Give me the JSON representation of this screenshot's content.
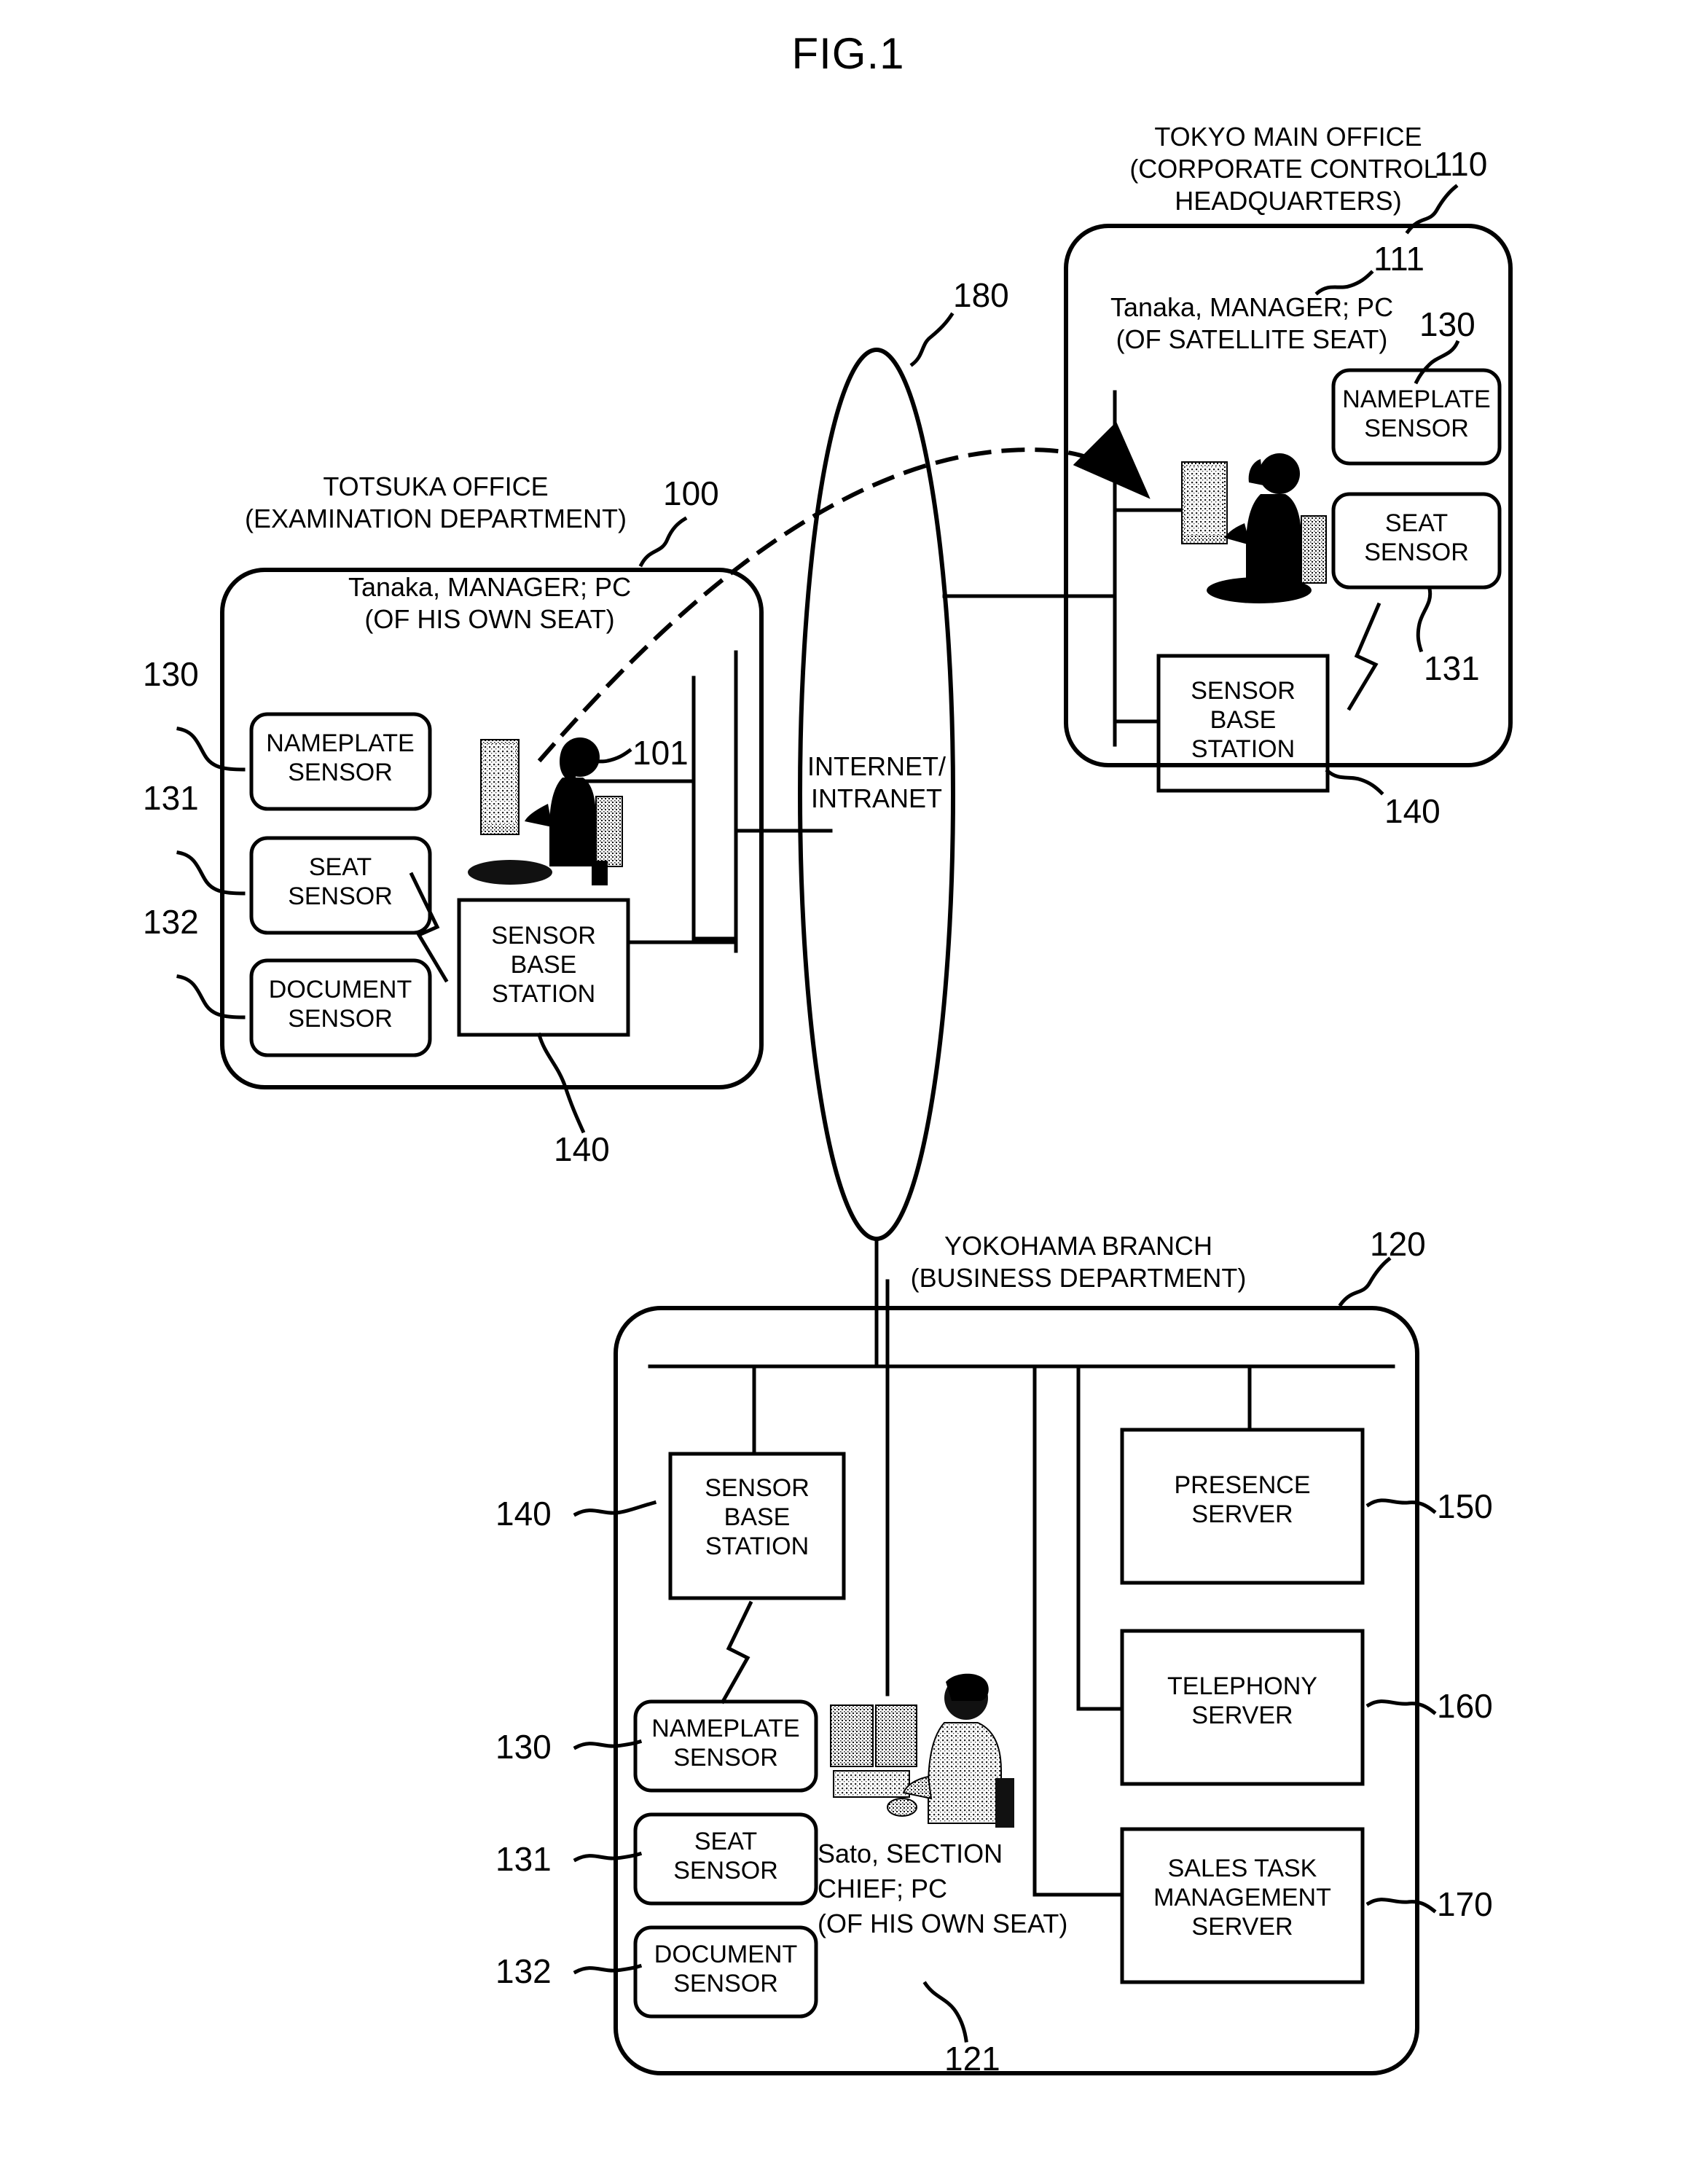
{
  "figure": {
    "title": "FIG.1"
  },
  "network": {
    "label_line1": "INTERNET/",
    "label_line2": "INTRANET",
    "ref": "180"
  },
  "offices": {
    "totsuka": {
      "title_line1": "TOTSUKA OFFICE",
      "title_line2": "(EXAMINATION DEPARTMENT)",
      "ref": "100",
      "person_line1": "Tanaka, MANAGER; PC",
      "person_line2": "(OF HIS OWN SEAT)",
      "person_ref": "101",
      "sensors": [
        {
          "ref": "130",
          "line1": "NAMEPLATE",
          "line2": "SENSOR"
        },
        {
          "ref": "131",
          "line1": "SEAT",
          "line2": "SENSOR"
        },
        {
          "ref": "132",
          "line1": "DOCUMENT",
          "line2": "SENSOR"
        }
      ],
      "base_station": {
        "ref": "140",
        "line1": "SENSOR",
        "line2": "BASE",
        "line3": "STATION"
      }
    },
    "tokyo": {
      "title_line1": "TOKYO MAIN OFFICE",
      "title_line2": "(CORPORATE CONTROL",
      "title_line3": "HEADQUARTERS)",
      "ref": "110",
      "person_line1": "Tanaka, MANAGER; PC",
      "person_line2": "(OF SATELLITE SEAT)",
      "person_ref": "111",
      "sensors": [
        {
          "ref": "130",
          "line1": "NAMEPLATE",
          "line2": "SENSOR"
        },
        {
          "ref": "131",
          "line1": "SEAT",
          "line2": "SENSOR"
        }
      ],
      "base_station": {
        "ref": "140",
        "line1": "SENSOR",
        "line2": "BASE",
        "line3": "STATION"
      }
    },
    "yokohama": {
      "title_line1": "YOKOHAMA BRANCH",
      "title_line2": "(BUSINESS DEPARTMENT)",
      "ref": "120",
      "person_line1": "Sato, SECTION",
      "person_line2": "CHIEF; PC",
      "person_line3": "(OF HIS OWN SEAT)",
      "person_ref": "121",
      "sensors": [
        {
          "ref": "130",
          "line1": "NAMEPLATE",
          "line2": "SENSOR"
        },
        {
          "ref": "131",
          "line1": "SEAT",
          "line2": "SENSOR"
        },
        {
          "ref": "132",
          "line1": "DOCUMENT",
          "line2": "SENSOR"
        }
      ],
      "base_station": {
        "ref": "140",
        "line1": "SENSOR",
        "line2": "BASE",
        "line3": "STATION"
      },
      "servers": [
        {
          "ref": "150",
          "line1": "PRESENCE",
          "line2": "SERVER",
          "line3": ""
        },
        {
          "ref": "160",
          "line1": "TELEPHONY",
          "line2": "SERVER",
          "line3": ""
        },
        {
          "ref": "170",
          "line1": "SALES TASK",
          "line2": "MANAGEMENT",
          "line3": "SERVER"
        }
      ]
    }
  },
  "colors": {
    "ink": "#000000",
    "paper": "#ffffff"
  }
}
